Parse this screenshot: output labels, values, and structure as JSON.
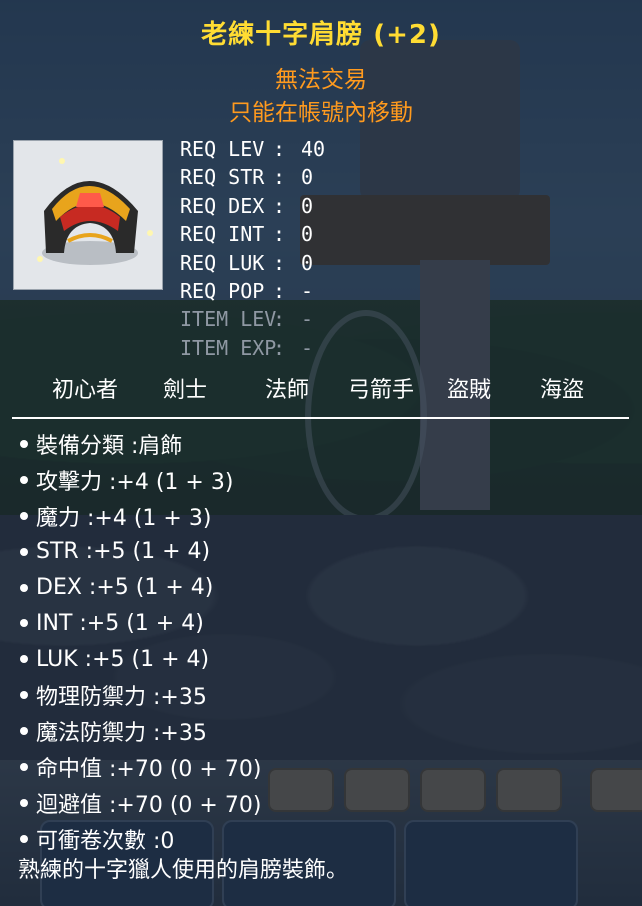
{
  "item": {
    "name": "老練十字肩膀 (+2)",
    "trade_note": "無法交易",
    "account_note": "只能在帳號內移動",
    "icon": "shoulder-armor-icon"
  },
  "requirements": [
    {
      "key": "REQ LEV",
      "sep": ":",
      "value": "40",
      "dim": false
    },
    {
      "key": "REQ STR",
      "sep": ":",
      "value": "0",
      "dim": false
    },
    {
      "key": "REQ DEX",
      "sep": ":",
      "value": "0",
      "dim": false
    },
    {
      "key": "REQ INT",
      "sep": ":",
      "value": "0",
      "dim": false
    },
    {
      "key": "REQ LUK",
      "sep": ":",
      "value": "0",
      "dim": false
    },
    {
      "key": "REQ POP",
      "sep": ":",
      "value": "-",
      "dim": false
    },
    {
      "key": "ITEM LEV",
      "sep": ":",
      "value": "-",
      "dim": true
    },
    {
      "key": "ITEM EXP",
      "sep": ":",
      "value": "-",
      "dim": true
    }
  ],
  "jobs": [
    "初心者",
    "劍士",
    "法師",
    "弓箭手",
    "盜賊",
    "海盜"
  ],
  "stats": [
    "裝備分類 :肩飾",
    "攻擊力 :+4 (1 + 3)",
    "魔力 :+4 (1 + 3)",
    "STR :+5 (1 + 4)",
    "DEX :+5 (1 + 4)",
    "INT :+5 (1 + 4)",
    "LUK :+5 (1 + 4)",
    "物理防禦力 :+35",
    "魔法防禦力 :+35",
    "命中值 :+70 (0 + 70)",
    "迴避值 :+70 (0 + 70)",
    "可衝卷次數 :0"
  ],
  "description": "熟練的十字獵人使用的肩膀裝飾。",
  "colors": {
    "title": "#ffdc33",
    "note": "#ff9a1e",
    "text": "#ffffff",
    "dim_text": "#8f98a3"
  }
}
